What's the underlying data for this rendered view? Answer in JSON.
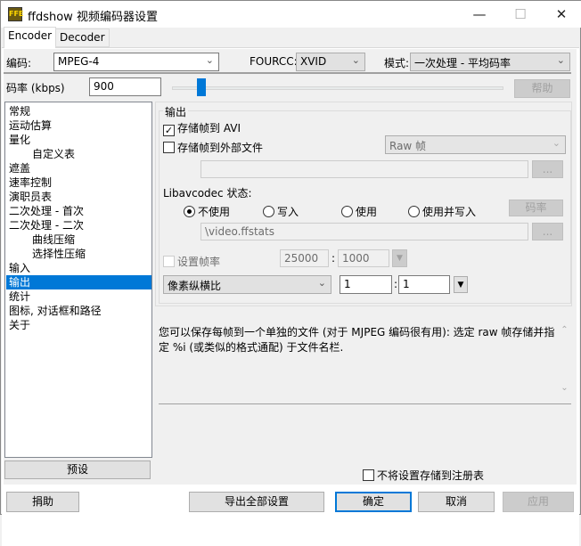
{
  "window": {
    "title": "ffdshow 视频编码器设置",
    "minimize": "—",
    "maximize": "☐",
    "close": "✕",
    "logo": "FFE"
  },
  "tabs": [
    {
      "label": "Encoder"
    },
    {
      "label": "Decoder"
    }
  ],
  "codec": {
    "label": "编码:",
    "value": "MPEG-4"
  },
  "fourcc": {
    "label": "FOURCC:",
    "value": "XVID"
  },
  "mode": {
    "label": "模式:",
    "value": "一次处理 - 平均码率"
  },
  "bitrate": {
    "label": "码率 (kbps)",
    "value": "900",
    "slider_fraction": 0.09
  },
  "help_button": "帮助",
  "tree": [
    {
      "label": "常规"
    },
    {
      "label": "运动估算"
    },
    {
      "label": "量化"
    },
    {
      "label": "自定义表"
    },
    {
      "label": "遮盖"
    },
    {
      "label": "速率控制"
    },
    {
      "label": "演职员表"
    },
    {
      "label": "二次处理 - 首次"
    },
    {
      "label": "二次处理 - 二次"
    },
    {
      "label": "曲线压缩"
    },
    {
      "label": "选择性压缩"
    },
    {
      "label": "输入"
    },
    {
      "label": "输出"
    },
    {
      "label": "统计"
    },
    {
      "label": "图标, 对话框和路径"
    },
    {
      "label": "关于"
    }
  ],
  "preset_button": "预设",
  "output": {
    "group_label": "输出",
    "store_avi": "存储帧到 AVI",
    "store_ext": "存储帧到外部文件",
    "ext_format": "Raw 帧",
    "browse": "...",
    "libav_label": "Libavcodec 状态:",
    "radios": [
      "不使用",
      "写入",
      "使用",
      "使用并写入"
    ],
    "rate_button": "码率",
    "stats_path": "\\video.ffstats",
    "set_fps": "设置帧率",
    "fps_num": "25000",
    "fps_den": "1000",
    "colon": ":",
    "par_select": "像素纵横比",
    "par_num": "1",
    "par_den": "1"
  },
  "description": "您可以保存每帧到一个单独的文件 (对于 MJPEG 编码很有用): 选定 raw 帧存储并指定 %i (或类似的格式通配) 于文件名栏.",
  "no_registry": "不将设置存储到注册表",
  "buttons": {
    "donate": "捐助",
    "export": "导出全部设置",
    "ok": "确定",
    "cancel": "取消",
    "apply": "应用"
  },
  "colors": {
    "accent": "#0078d7"
  }
}
